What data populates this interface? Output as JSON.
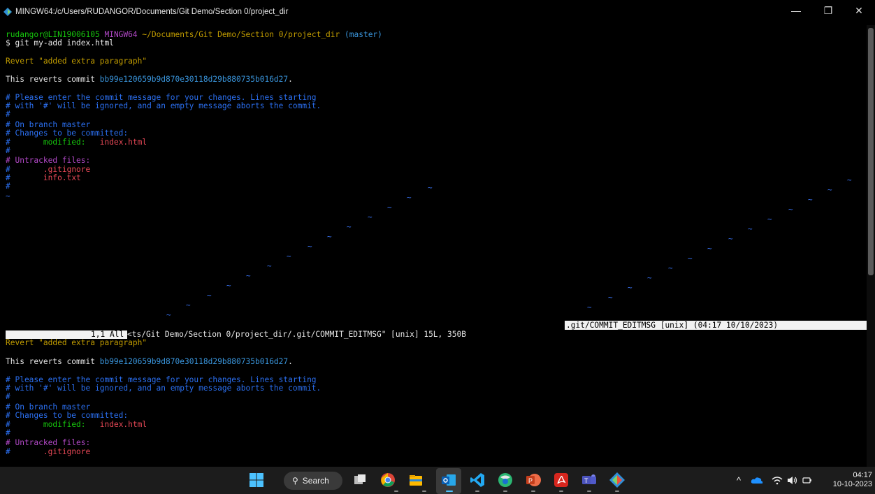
{
  "window": {
    "title": "MINGW64:/c/Users/RUDANGOR/Documents/Git Demo/Section 0/project_dir",
    "minimize": "—",
    "maximize": "❐",
    "close": "✕"
  },
  "prompt": {
    "user_host": "rudangor@LIN19006105",
    "shell": "MINGW64",
    "path": "~/Documents/Git Demo/Section 0/project_dir",
    "branch": "(master)",
    "command": "$ git my-add index.html"
  },
  "top_pane": {
    "revert_line": "Revert \"added extra paragraph\"",
    "reverts_prefix": "This reverts commit ",
    "reverts_hash": "bb99e120659b9d870e30118d29b880735b016d27",
    "reverts_suffix": ".",
    "comment1": "# Please enter the commit message for your changes. Lines starting",
    "comment2": "# with '#' will be ignored, and an empty message aborts the commit.",
    "hash_line": "#",
    "branch_line": "# On branch master",
    "changes_line": "# Changes to be committed:",
    "modified_prefix": "#",
    "modified_label": "modified:",
    "modified_file": "index.html",
    "untracked_line": "# Untracked files:",
    "untracked_1": ".gitignore",
    "untracked_2": "info.txt",
    "tilde": "~"
  },
  "status": {
    "position": "1,1",
    "all": "All",
    "file_info": "<ts/Git Demo/Section 0/project_dir/.git/COMMIT_EDITMSG\" [unix] 15L, 350B",
    "right_status": ".git/COMMIT_EDITMSG [unix] (04:17 10/10/2023)"
  },
  "bottom_pane": {
    "revert_line": "Revert \"added extra paragraph\"",
    "reverts_prefix": "This reverts commit ",
    "reverts_hash": "bb99e120659b9d870e30118d29b880735b016d27",
    "reverts_suffix": ".",
    "comment1": "# Please enter the commit message for your changes. Lines starting",
    "comment2": "# with '#' will be ignored, and an empty message aborts the commit.",
    "hash_line": "#",
    "branch_line": "# On branch master",
    "changes_line": "# Changes to be committed:",
    "modified_prefix": "#",
    "modified_label": "modified:",
    "modified_file": "index.html",
    "untracked_line": "# Untracked files:",
    "untracked_1": ".gitignore"
  },
  "taskbar": {
    "search_label": "Search",
    "time": "04:17",
    "date": "10-10-2023",
    "tray_chevron": "^",
    "apps": [
      "windows-start",
      "task-view",
      "chrome",
      "file-explorer",
      "outlook",
      "vscode",
      "browser",
      "powerpoint",
      "acrobat",
      "teams",
      "git-bash"
    ]
  }
}
